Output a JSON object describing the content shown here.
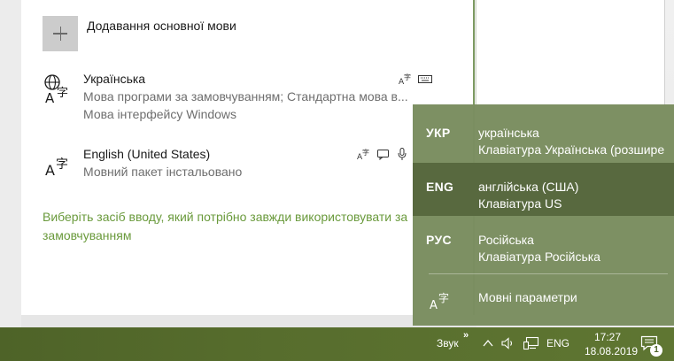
{
  "settings": {
    "add_language_label": "Додавання основної мови",
    "languages": [
      {
        "name": "Українська",
        "sub1": "Мова програми за замовчуванням; Стандартна мова в...",
        "sub2": "Мова інтерфейсу Windows",
        "features": [
          "handwriting-icon",
          "keyboard-icon"
        ]
      },
      {
        "name": "English (United States)",
        "sub1": "Мовний пакет інстальовано",
        "features": [
          "handwriting-icon",
          "speech-icon",
          "microphone-icon"
        ]
      }
    ],
    "input_method_link": "Виберіть засіб вводу, який потрібно завжди використовувати за замовчуванням"
  },
  "flyout": {
    "items": [
      {
        "code": "УКР",
        "name": "українська",
        "keyboard": "Клавіатура Українська (розширена)",
        "active": false
      },
      {
        "code": "ENG",
        "name": "англійська (США)",
        "keyboard": "Клавіатура US",
        "active": true
      },
      {
        "code": "РУС",
        "name": "Російська",
        "keyboard": "Клавіатура Російська",
        "active": false
      }
    ],
    "settings_label": "Мовні параметри"
  },
  "taskbar": {
    "toolbar_label": "Звук",
    "overflow": "»",
    "language": "ENG",
    "time": "17:27",
    "date": "18.08.2019",
    "notification_count": "1"
  },
  "colors": {
    "accent": "#7a8e60",
    "accent_active": "#58693f",
    "link": "#6a9a3c",
    "taskbar": "#566b2c"
  }
}
